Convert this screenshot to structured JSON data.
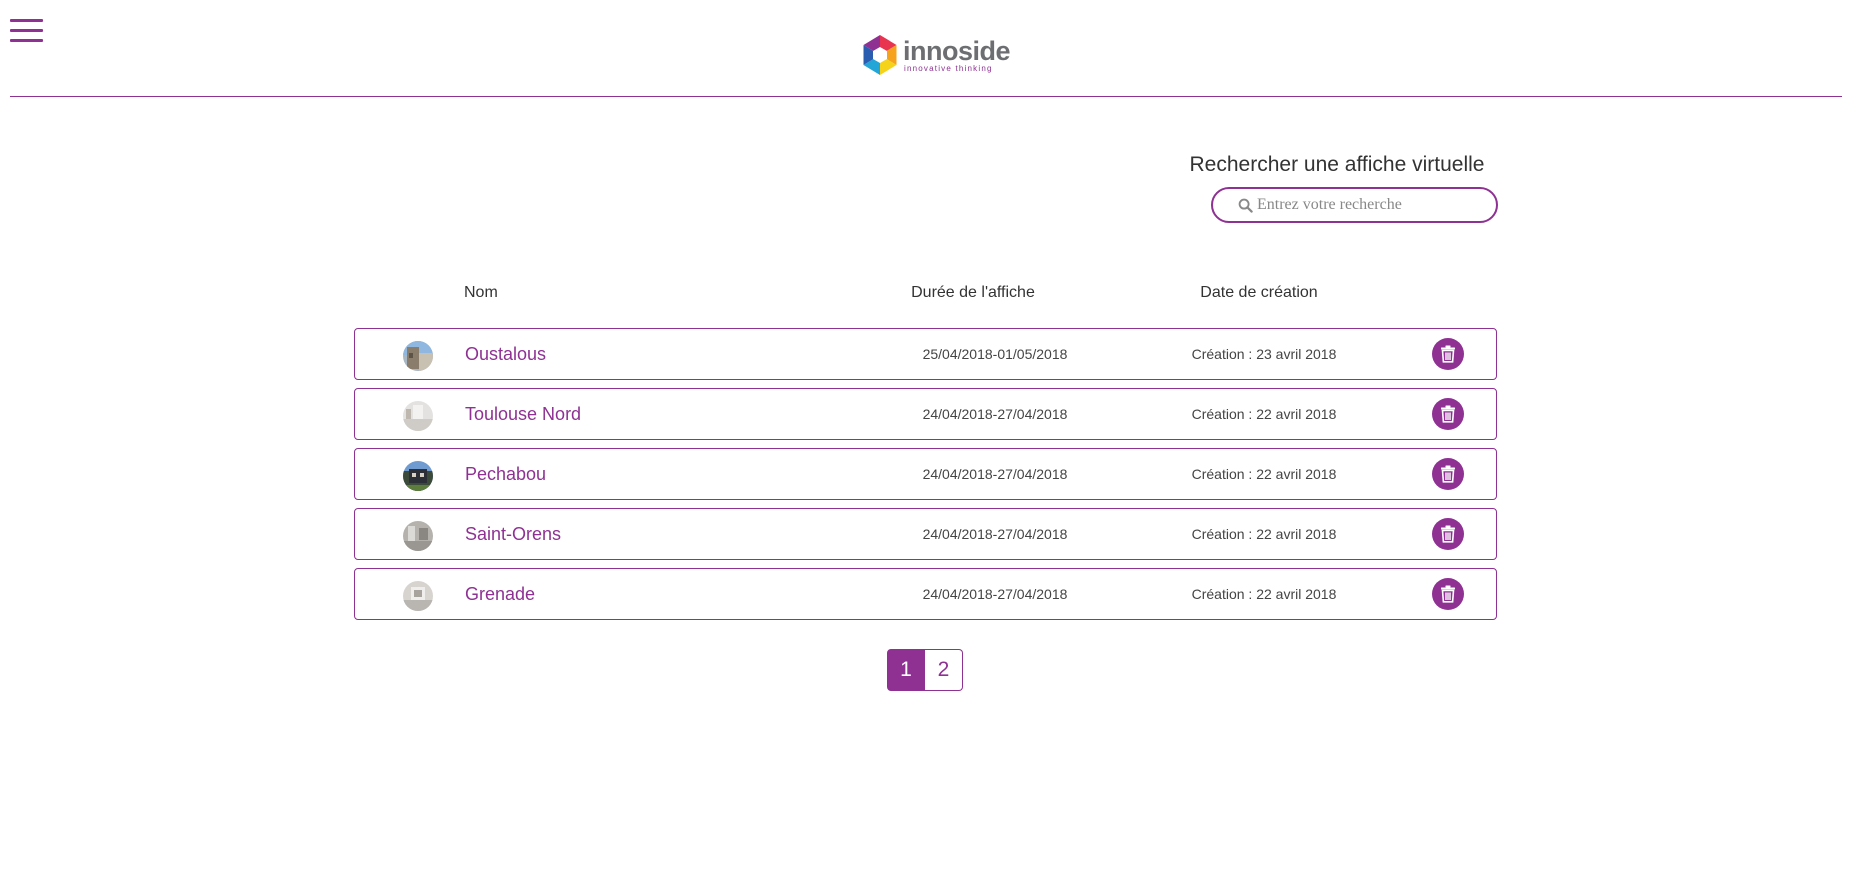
{
  "header": {
    "brand_name": "innoside",
    "brand_tagline": "innovative thinking",
    "accent_color": "#8e3193"
  },
  "search": {
    "title": "Rechercher une affiche virtuelle",
    "placeholder": "Entrez votre recherche",
    "value": ""
  },
  "table": {
    "columns": [
      "Nom",
      "Durée de l'affiche",
      "Date de création"
    ],
    "rows": [
      {
        "name": "Oustalous",
        "duree": "25/04/2018-01/05/2018",
        "date": "Création : 23 avril 2018"
      },
      {
        "name": "Toulouse Nord",
        "duree": "24/04/2018-27/04/2018",
        "date": "Création : 22 avril 2018"
      },
      {
        "name": "Pechabou",
        "duree": "24/04/2018-27/04/2018",
        "date": "Création : 22 avril 2018"
      },
      {
        "name": "Saint-Orens",
        "duree": "24/04/2018-27/04/2018",
        "date": "Création : 22 avril 2018"
      },
      {
        "name": "Grenade",
        "duree": "24/04/2018-27/04/2018",
        "date": "Création : 22 avril 2018"
      }
    ]
  },
  "pagination": {
    "pages": [
      "1",
      "2"
    ],
    "current": "1"
  }
}
